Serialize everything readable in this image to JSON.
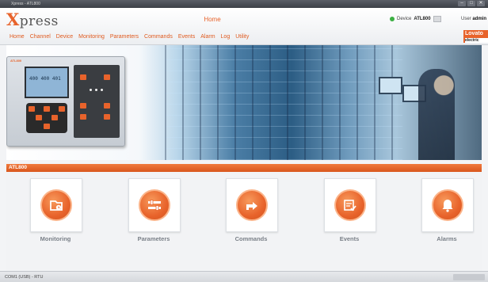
{
  "window": {
    "title": "Xpress - ATL800",
    "controls": [
      "–",
      "□",
      "✕"
    ]
  },
  "header": {
    "logo_x": "X",
    "logo_rest": "press",
    "page_title": "Home",
    "device_label": "Device",
    "device_name": "ATL800",
    "user_label": "User",
    "user_name": "admin",
    "brand": "Lovato",
    "brand_sub": "electric"
  },
  "menu": {
    "items": [
      "Home",
      "Channel",
      "Device",
      "Monitoring",
      "Parameters",
      "Commands",
      "Events",
      "Alarm",
      "Log",
      "Utility"
    ]
  },
  "banner": {
    "device_tag": "ATL800",
    "lcd_text": "400 400 401"
  },
  "section": {
    "title": "ATL800"
  },
  "tiles": [
    {
      "label": "Monitoring",
      "icon": "monitoring-icon"
    },
    {
      "label": "Parameters",
      "icon": "parameters-icon"
    },
    {
      "label": "Commands",
      "icon": "commands-icon"
    },
    {
      "label": "Events",
      "icon": "events-icon"
    },
    {
      "label": "Alarms",
      "icon": "alarms-icon"
    }
  ],
  "statusbar": {
    "connection": "COM1 (USB) - RTU"
  },
  "colors": {
    "accent": "#e8632b",
    "status_online": "#3cb043",
    "tile_label": "#7a8088"
  }
}
